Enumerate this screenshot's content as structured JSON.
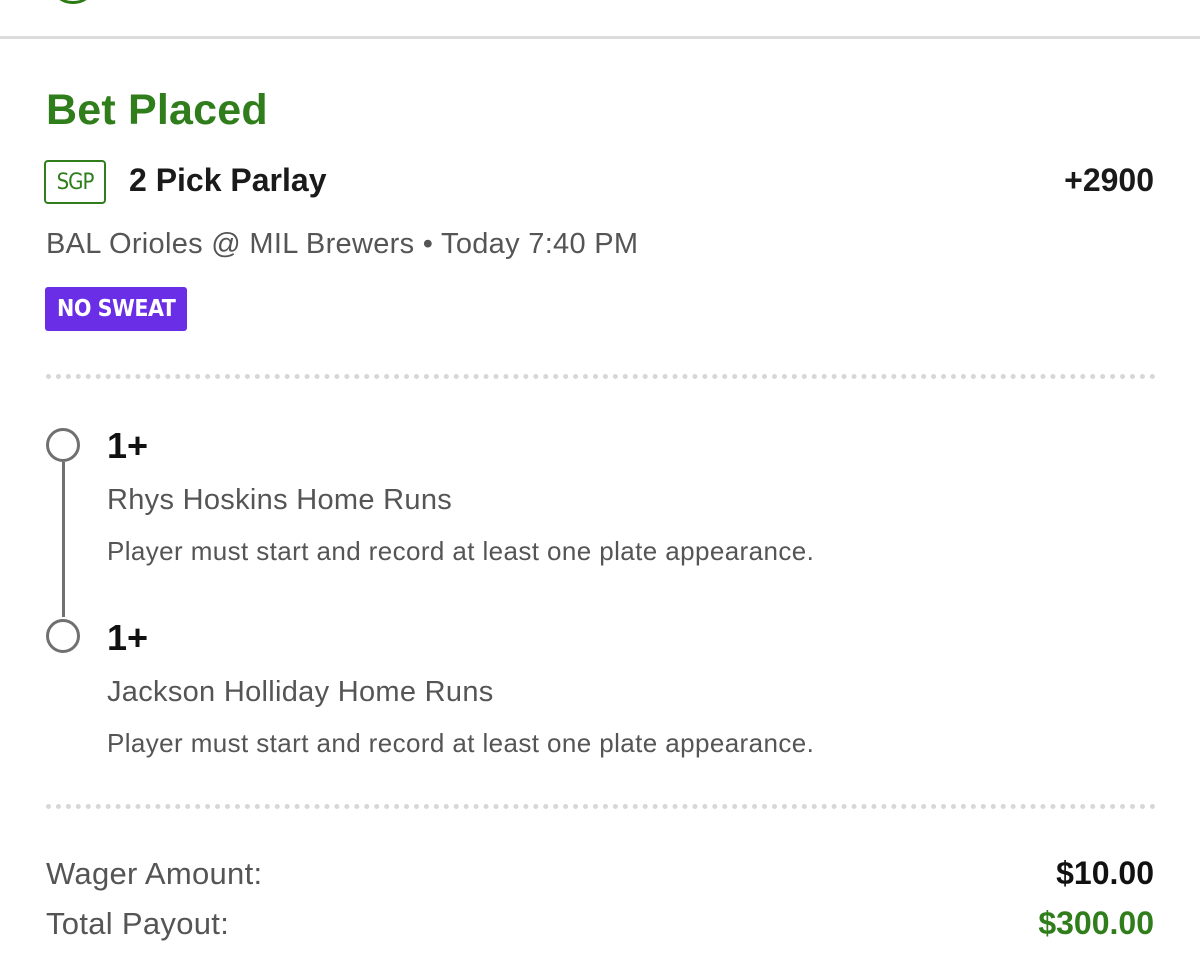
{
  "bet": {
    "status": "Bet Placed",
    "type_badge": "SGP",
    "title": "2 Pick Parlay",
    "odds": "+2900",
    "event": "BAL Orioles @ MIL Brewers • Today 7:40 PM",
    "promo_badge": "NO SWEAT"
  },
  "legs": [
    {
      "line": "1+",
      "market": "Rhys Hoskins Home Runs",
      "rule": "Player must start and record at least one plate appearance."
    },
    {
      "line": "1+",
      "market": "Jackson Holliday Home Runs",
      "rule": "Player must start and record at least one plate appearance."
    }
  ],
  "summary": {
    "wager_label": "Wager Amount:",
    "wager_value": "$10.00",
    "payout_label": "Total Payout:",
    "payout_value": "$300.00"
  },
  "colors": {
    "status_green": "#2f7d1b",
    "payout_green": "#2f7d1b",
    "promo_purple": "#6a2ee6",
    "leg_circle_gray": "#707070"
  },
  "icons": {
    "top_partial": "logo-icon",
    "leg_marker": "circle-outline-icon"
  }
}
